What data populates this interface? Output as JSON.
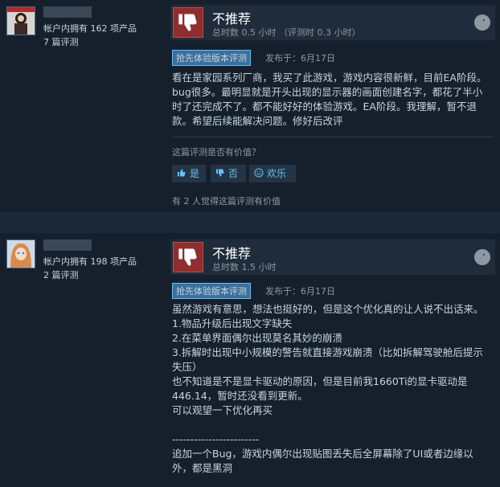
{
  "reviews": [
    {
      "owned": "帐户内拥有 162 项产品",
      "review_count": "7 篇评测",
      "verdict": "不推荐",
      "hours": "总时数 0.5 小时 （评测时 0.3 小时）",
      "badge": "抢先体验版本评测",
      "posted": "发布于：6月17日",
      "text": "看在是家园系列厂商，我买了此游戏，游戏内容很新鲜，目前EA阶段。bug很多。最明显就是开头出现的显示器的画面创建名字，都花了半小时了还完成不了。都不能好好的体验游戏。EA阶段。我理解，暂不退款。希望后续能解决问题。修好后改评",
      "helpful_question": "这篇评测是否有价值？",
      "btn_yes": "是",
      "btn_no": "否",
      "btn_funny": "欢乐",
      "helpful_count": "有 2 人觉得这篇评测有价值"
    },
    {
      "owned": "帐户内拥有 198 项产品",
      "review_count": "2 篇评测",
      "verdict": "不推荐",
      "hours": "总时数 1.5 小时",
      "badge": "抢先体验版本评测",
      "posted": "发布于：6月17日",
      "lines": [
        "虽然游戏有意思，想法也挺好的，但是这个优化真的让人说不出话来。",
        "1.物品升级后出现文字缺失",
        "2.在菜单界面偶尔出现莫名其妙的崩溃",
        "3.拆解时出现中小规模的警告就直接游戏崩溃（比如拆解驾驶舱后提示失压）",
        "也不知道是不是显卡驱动的原因，但是目前我1660Ti的显卡驱动是446.14，暂时还没看到更新。",
        "可以观望一下优化再买",
        "",
        "------------------------",
        "追加一个Bug，游戏内偶尔出现贴图丢失后全屏幕除了UI或者边缘以外，都是黑洞"
      ]
    }
  ],
  "colors": {
    "background": "#1b2838",
    "card": "#16202d",
    "accent": "#66c0f4",
    "thumb_down": "#8e2e2e"
  },
  "icons": [
    "thumbs-down-icon",
    "steam-icon",
    "thumbs-up-icon",
    "smile-icon"
  ]
}
